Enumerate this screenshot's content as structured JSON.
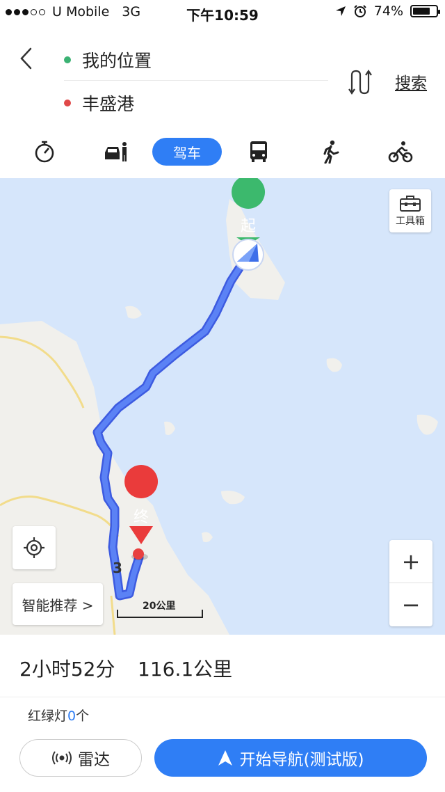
{
  "status_bar": {
    "carrier": "U Mobile",
    "network": "3G",
    "time": "下午10:59",
    "battery": "74%",
    "battery_level": 0.74
  },
  "header": {
    "origin": "我的位置",
    "destination": "丰盛港",
    "search_label": "搜索",
    "origin_dot_color": "#3bb273",
    "destination_dot_color": "#e04848"
  },
  "modes": {
    "active_label": "驾车",
    "items": [
      "stopwatch-icon",
      "taxi-icon",
      "car",
      "bus-icon",
      "walk-icon",
      "bike-icon"
    ]
  },
  "map": {
    "toolbox_label": "工具箱",
    "start_pin": "起",
    "end_pin": "终",
    "road_number": "3",
    "scale_label": "20公里",
    "recommend_label": "智能推荐 >",
    "zoom_in": "+",
    "zoom_out": "−",
    "route_color": "#4a72ef",
    "water_color": "#d6e6fb"
  },
  "route": {
    "duration": "2小时52分",
    "distance": "116.1公里",
    "traffic_prefix": "红绿灯",
    "traffic_count": "0",
    "traffic_suffix": "个"
  },
  "actions": {
    "radar_label": "雷达",
    "navigate_label": "开始导航(测试版)"
  }
}
